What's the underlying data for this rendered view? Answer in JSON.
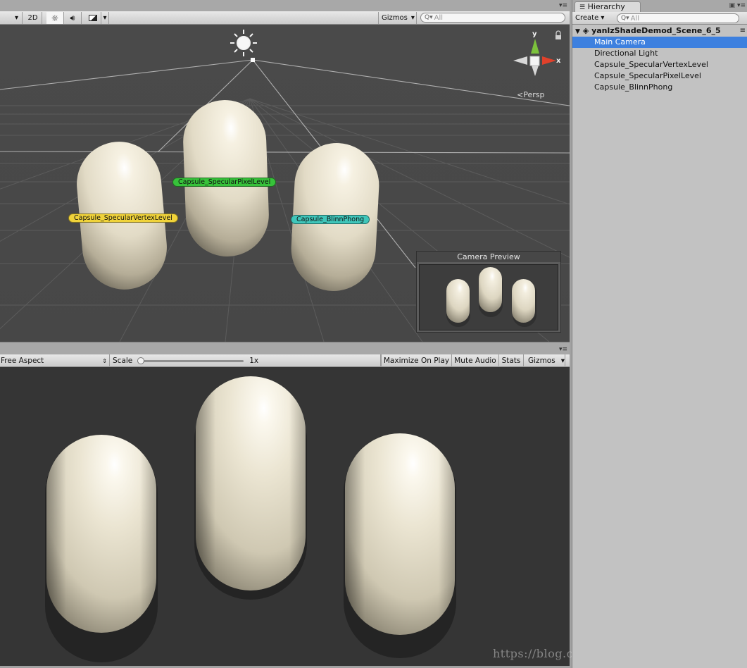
{
  "scene_toolbar": {
    "mode_2d": "2D",
    "gizmos_label": "Gizmos",
    "search_placeholder": "All"
  },
  "scene": {
    "labels": {
      "vertex": "Capsule_SpecularVertexLevel",
      "pixel": "Capsule_SpecularPixelLevel",
      "blinn": "Capsule_BlinnPhong"
    },
    "axes": {
      "y": "y",
      "x": "x"
    },
    "projection": "Persp",
    "camera_preview_title": "Camera Preview"
  },
  "game_toolbar": {
    "aspect": "Free Aspect",
    "scale_label": "Scale",
    "scale_value": "1x",
    "scale_level": 0.0,
    "maximize": "Maximize On Play",
    "mute": "Mute Audio",
    "stats": "Stats",
    "gizmos_label": "Gizmos"
  },
  "hierarchy": {
    "tab_label": "Hierarchy",
    "create_label": "Create",
    "search_placeholder": "All",
    "scene_name": "yanlzShadeDemod_Scene_6_5",
    "items": [
      {
        "label": "Main Camera",
        "selected": true
      },
      {
        "label": "Directional Light",
        "selected": false
      },
      {
        "label": "Capsule_SpecularVertexLevel",
        "selected": false
      },
      {
        "label": "Capsule_SpecularPixelLevel",
        "selected": false
      },
      {
        "label": "Capsule_BlinnPhong",
        "selected": false
      }
    ]
  },
  "watermark": "https://blog.csdn.net/VRunSoftYanlz",
  "colors": {
    "selection": "#3d80df",
    "vertex_label": "#f0d33a",
    "pixel_label": "#37c23a",
    "blinn_label": "#3fc6ba",
    "capsule": "#e7e1cd"
  }
}
